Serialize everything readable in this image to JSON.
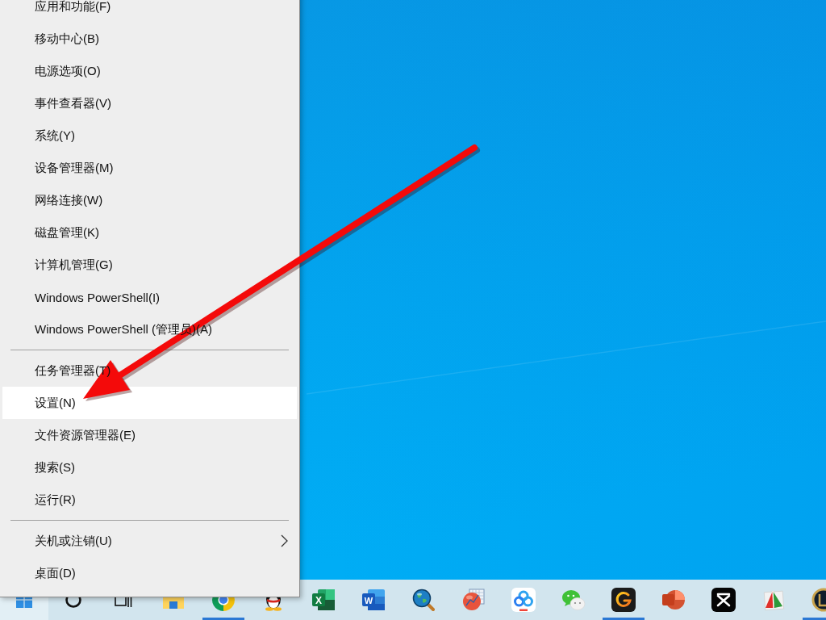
{
  "menu": {
    "groups": [
      {
        "items": [
          {
            "label": "应用和功能(F)",
            "selected": false,
            "submenu": false
          },
          {
            "label": "移动中心(B)",
            "selected": false,
            "submenu": false
          },
          {
            "label": "电源选项(O)",
            "selected": false,
            "submenu": false
          },
          {
            "label": "事件查看器(V)",
            "selected": false,
            "submenu": false
          },
          {
            "label": "系统(Y)",
            "selected": false,
            "submenu": false
          },
          {
            "label": "设备管理器(M)",
            "selected": false,
            "submenu": false
          },
          {
            "label": "网络连接(W)",
            "selected": false,
            "submenu": false
          },
          {
            "label": "磁盘管理(K)",
            "selected": false,
            "submenu": false
          },
          {
            "label": "计算机管理(G)",
            "selected": false,
            "submenu": false
          },
          {
            "label": "Windows PowerShell(I)",
            "selected": false,
            "submenu": false
          },
          {
            "label": "Windows PowerShell (管理员)(A)",
            "selected": false,
            "submenu": false
          }
        ]
      },
      {
        "items": [
          {
            "label": "任务管理器(T)",
            "selected": false,
            "submenu": false
          },
          {
            "label": "设置(N)",
            "selected": true,
            "submenu": false
          },
          {
            "label": "文件资源管理器(E)",
            "selected": false,
            "submenu": false
          },
          {
            "label": "搜索(S)",
            "selected": false,
            "submenu": false
          },
          {
            "label": "运行(R)",
            "selected": false,
            "submenu": false
          }
        ]
      },
      {
        "items": [
          {
            "label": "关机或注销(U)",
            "selected": false,
            "submenu": true
          },
          {
            "label": "桌面(D)",
            "selected": false,
            "submenu": false
          }
        ]
      }
    ]
  },
  "taskbar": {
    "items": [
      {
        "kind": "start",
        "pressed": true,
        "running": false
      },
      {
        "kind": "search",
        "pressed": false,
        "running": false
      },
      {
        "kind": "taskview",
        "pressed": false,
        "running": false
      },
      {
        "kind": "folder",
        "pressed": false,
        "running": false
      },
      {
        "kind": "browser",
        "pressed": false,
        "running": true
      },
      {
        "kind": "penguin",
        "pressed": false,
        "running": false
      },
      {
        "kind": "spreadsheet",
        "label": "X",
        "pressed": false,
        "running": false
      },
      {
        "kind": "document",
        "label": "W",
        "pressed": false,
        "running": false
      },
      {
        "kind": "globe",
        "pressed": false,
        "running": false
      },
      {
        "kind": "chart",
        "pressed": false,
        "running": false
      },
      {
        "kind": "cloud",
        "pressed": false,
        "running": false
      },
      {
        "kind": "chat",
        "pressed": false,
        "running": false
      },
      {
        "kind": "ringtile",
        "pressed": false,
        "running": true
      },
      {
        "kind": "presentation",
        "pressed": false,
        "running": false
      },
      {
        "kind": "cliptile",
        "pressed": false,
        "running": false
      },
      {
        "kind": "triangle",
        "pressed": false,
        "running": false
      },
      {
        "kind": "emblem",
        "pressed": false,
        "running": true
      }
    ]
  }
}
